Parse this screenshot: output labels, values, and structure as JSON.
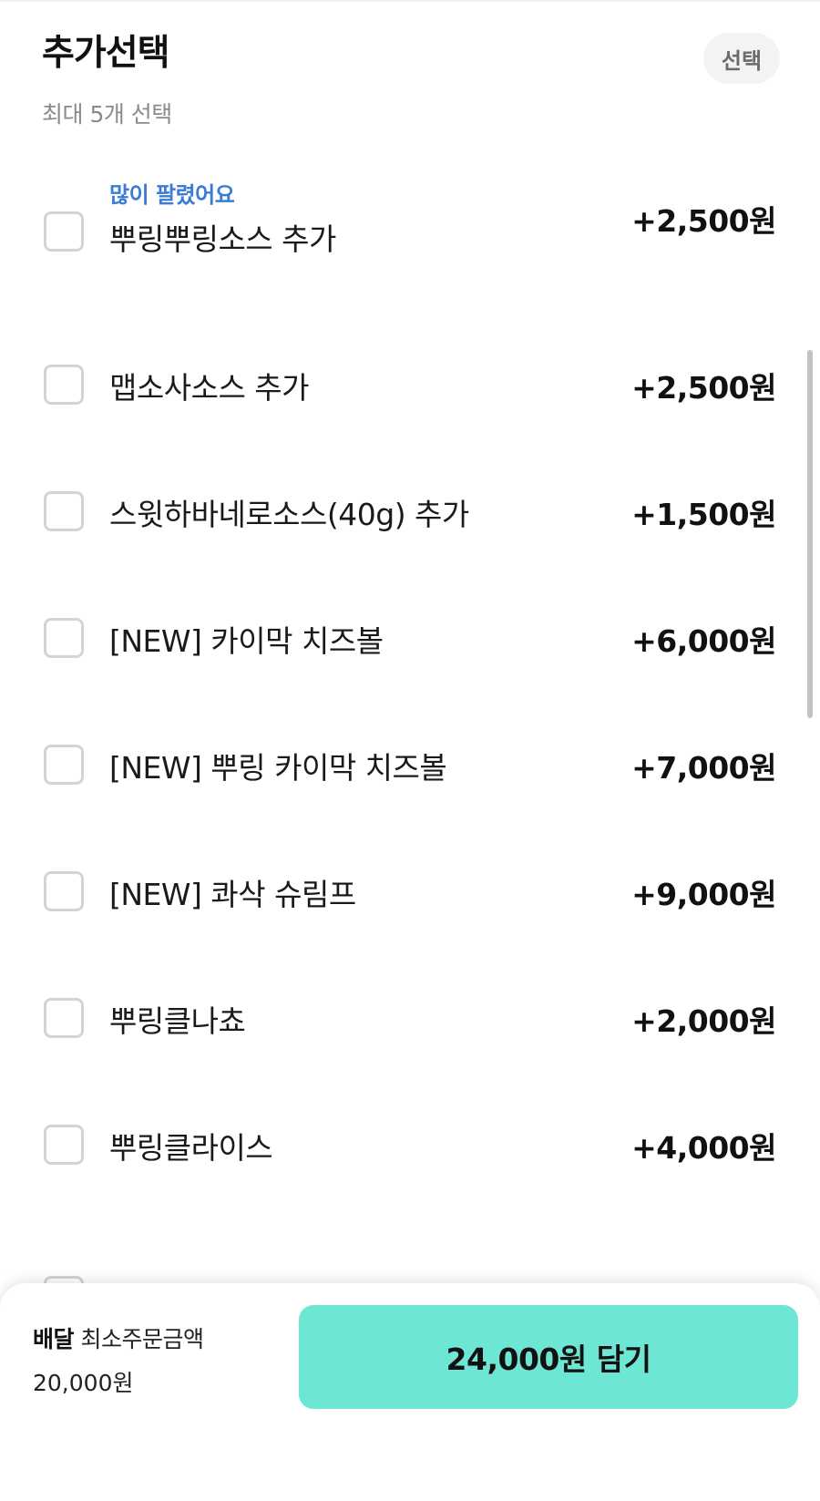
{
  "header": {
    "title": "추가선택",
    "subtitle": "최대 5개 선택",
    "badge": "선택"
  },
  "options": [
    {
      "badge": "많이 팔렸어요",
      "label": "뿌링뿌링소스 추가",
      "price": "+2,500원",
      "checked": false
    },
    {
      "label": "맵소사소스 추가",
      "price": "+2,500원",
      "checked": false
    },
    {
      "label": "스윗하바네로소스(40g) 추가",
      "price": "+1,500원",
      "checked": false
    },
    {
      "label": "[NEW] 카이막 치즈볼",
      "price": "+6,000원",
      "checked": false
    },
    {
      "label": "[NEW] 뿌링 카이막 치즈볼",
      "price": "+7,000원",
      "checked": false
    },
    {
      "label": "[NEW] 콰삭 슈림프",
      "price": "+9,000원",
      "checked": false
    },
    {
      "label": "뿌링클나쵸",
      "price": "+2,000원",
      "checked": false
    },
    {
      "label": "뿌링클라이스",
      "price": "+4,000원",
      "checked": false
    }
  ],
  "footer": {
    "delivery_type": "배달",
    "min_order_label": "최소주문금액",
    "min_order_amount": "20,000원",
    "cart_button_label": "24,000원 담기"
  },
  "colors": {
    "accent_button": "#6ee6d4",
    "badge_text": "#3a7bd5",
    "checkbox_border": "#d4d4d4"
  }
}
